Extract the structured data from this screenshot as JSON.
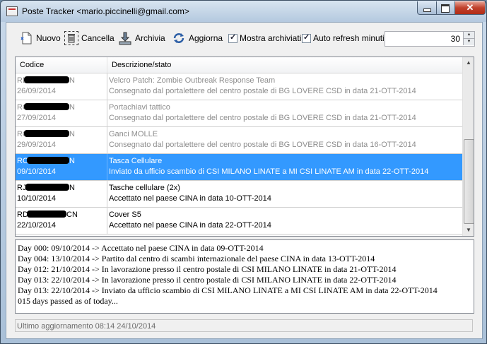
{
  "window": {
    "title": "Poste Tracker <mario.piccinelli@gmail.com>",
    "icon": "app-icon",
    "controls": {
      "minimize_icon": "minimize-icon",
      "maximize_icon": "maximize-icon",
      "close_label": "✕"
    }
  },
  "toolbar": {
    "new_label": "Nuovo",
    "delete_label": "Cancella",
    "archive_label": "Archivia",
    "refresh_label": "Aggiorna",
    "show_archived_label": "Mostra archiviati",
    "show_archived_checked": true,
    "auto_refresh_label": "Auto refresh minuti:",
    "auto_refresh_checked": true,
    "auto_refresh_value": "30"
  },
  "table": {
    "columns": [
      "Codice",
      "Descrizione/stato"
    ],
    "rows": [
      {
        "code_prefix": "RL",
        "code_suffix": "N",
        "date": "26/09/2014",
        "title": "Velcro Patch: Zombie Outbreak Response Team",
        "status": "Consegnato dal portalettere del centro postale di BG LOVERE CSD in data 21-OTT-2014",
        "archived": true,
        "selected": false
      },
      {
        "code_prefix": "RG",
        "code_suffix": "N",
        "date": "27/09/2014",
        "title": "Portachiavi tattico",
        "status": "Consegnato dal portalettere del centro postale di BG LOVERE CSD in data 21-OTT-2014",
        "archived": true,
        "selected": false
      },
      {
        "code_prefix": "RG",
        "code_suffix": "N",
        "date": "29/09/2014",
        "title": "Ganci MOLLE",
        "status": "Consegnato dal portalettere del centro postale di BG LOVERE CSD in data 16-OTT-2014",
        "archived": true,
        "selected": false
      },
      {
        "code_prefix": "RO",
        "code_suffix": "N",
        "date": "09/10/2014",
        "title": "Tasca Cellulare",
        "status": "Inviato da ufficio scambio di CSI MILANO LINATE a MI CSI LINATE AM in data 22-OTT-2014",
        "archived": false,
        "selected": true
      },
      {
        "code_prefix": "RJ",
        "code_suffix": "N",
        "date": "10/10/2014",
        "title": "Tasche cellulare (2x)",
        "status": "Accettato nel paese CINA in data 10-OTT-2014",
        "archived": false,
        "selected": false
      },
      {
        "code_prefix": "RD",
        "code_suffix": "CN",
        "date": "22/10/2014",
        "title": "Cover S5",
        "status": "Accettato nel paese CINA in data 22-OTT-2014",
        "archived": false,
        "selected": false
      }
    ]
  },
  "log": {
    "lines": [
      "Day 000: 09/10/2014 -> Accettato nel paese CINA in data 09-OTT-2014",
      "Day 004: 13/10/2014 -> Partito dal centro di scambi internazionale del paese CINA in data 13-OTT-2014",
      "Day 012: 21/10/2014 -> In lavorazione presso il centro postale di CSI MILANO LINATE in data 21-OTT-2014",
      "Day 013: 22/10/2014 -> In lavorazione presso il centro postale di CSI MILANO LINATE in data 22-OTT-2014",
      "Day 013: 22/10/2014 -> Inviato da ufficio scambio di CSI MILANO LINATE a MI CSI LINATE AM in data 22-OTT-2014",
      "015 days passed as of today..."
    ]
  },
  "status": {
    "text": "Ultimo aggiornamento 08:14 24/10/2014"
  },
  "colors": {
    "selection": "#3399ff",
    "archived_text": "#8d8d8d",
    "close_button": "#c0412c"
  }
}
